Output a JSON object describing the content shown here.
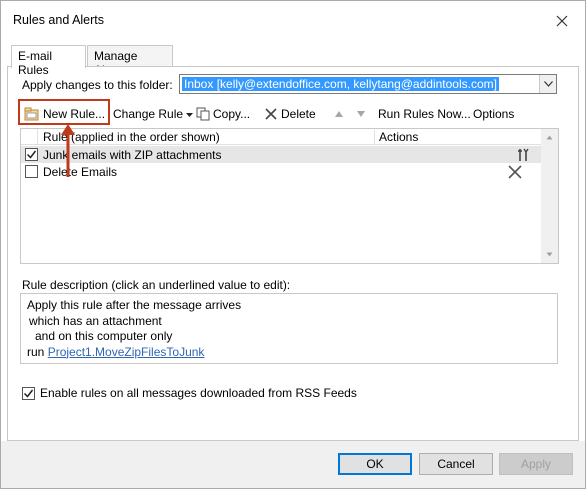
{
  "window": {
    "title": "Rules and Alerts"
  },
  "tabs": [
    {
      "label": "E-mail Rules",
      "active": true
    },
    {
      "label": "Manage Alerts",
      "active": false
    }
  ],
  "folder": {
    "label": "Apply changes to this folder:",
    "value": "Inbox [kelly@extendoffice.com, kellytang@addintools.com]"
  },
  "toolbar": {
    "new_rule": "New Rule...",
    "change_rule": "Change Rule",
    "copy": "Copy...",
    "delete": "Delete",
    "run_rules_now": "Run Rules Now...",
    "options": "Options"
  },
  "rules_list": {
    "header_rule": "Rule (applied in the order shown)",
    "header_actions": "Actions",
    "rows": [
      {
        "label": "Junk emails with ZIP attachments",
        "checked": true,
        "action_icon": "run-script-icon"
      },
      {
        "label": "Delete Emails",
        "checked": false,
        "action_icon": "delete-x-icon"
      }
    ]
  },
  "description": {
    "label": "Rule description (click an underlined value to edit):",
    "lines": [
      "Apply this rule after the message arrives",
      "which has an attachment",
      "and on this computer only"
    ],
    "run_prefix": "run",
    "run_link": "Project1.MoveZipFilesToJunk"
  },
  "rss": {
    "label": "Enable rules on all messages downloaded from RSS Feeds",
    "checked": true
  },
  "footer": {
    "ok": "OK",
    "cancel": "Cancel",
    "apply": "Apply"
  },
  "colors": {
    "highlight": "#c0391b",
    "selection": "#3399ff",
    "link": "#2f66b4",
    "arrow": "#c0391b"
  }
}
